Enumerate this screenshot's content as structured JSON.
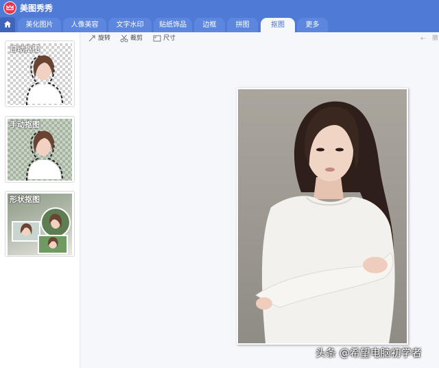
{
  "app": {
    "title": "美图秀秀",
    "accent": "#4f7ad6",
    "logo_color": "#e8364f"
  },
  "tabs": [
    {
      "label": "美化图片",
      "active": false
    },
    {
      "label": "人像美容",
      "active": false
    },
    {
      "label": "文字水印",
      "active": false
    },
    {
      "label": "贴纸饰品",
      "active": false
    },
    {
      "label": "边框",
      "active": false
    },
    {
      "label": "拼图",
      "active": false
    },
    {
      "label": "抠图",
      "active": true
    },
    {
      "label": "更多",
      "active": false
    }
  ],
  "toolbar": {
    "rotate_label": "旋转",
    "crop_label": "裁剪",
    "size_label": "尺寸",
    "redo_label": "撤"
  },
  "cutout_modes": [
    {
      "label": "自动抠图",
      "icon": "portrait-dashed-outline"
    },
    {
      "label": "手动抠图",
      "icon": "portrait-dashed-outline"
    },
    {
      "label": "形状抠图",
      "icon": "portrait-shapes"
    }
  ],
  "watermark": "头条 @希望电脑初学者"
}
